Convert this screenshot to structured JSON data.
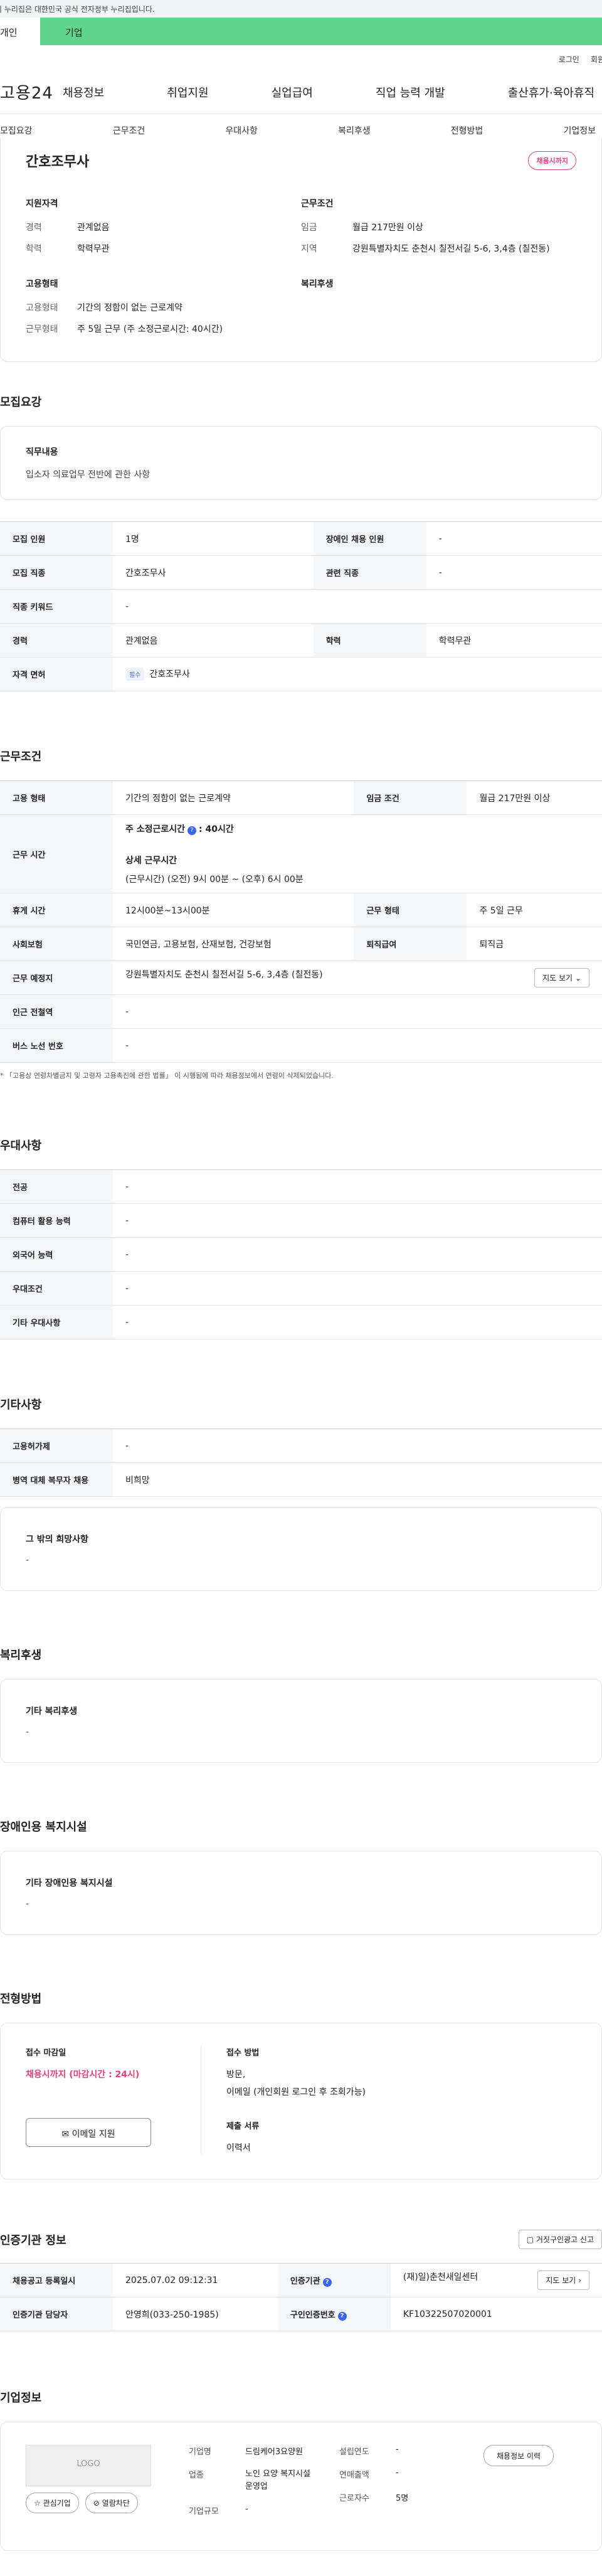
{
  "banner": "이 누리집은 대한민국 공식 전자정부 누리집입니다.",
  "top_tabs": [
    "개인",
    "기업"
  ],
  "util": [
    "로그인",
    "회원가입"
  ],
  "logo": "고용24",
  "gnb": [
    "채용정보",
    "취업지원",
    "실업급여",
    "직업 능력 개발",
    "출산휴가·육아휴직"
  ],
  "subnav": [
    "모집요강",
    "근무조건",
    "우대사항",
    "복리후생",
    "전형방법",
    "기업정보"
  ],
  "summary": {
    "title": "간호조무사",
    "badge": "채용시까지",
    "col1_title": "지원자격",
    "col1": [
      {
        "k": "경력",
        "v": "관계없음"
      },
      {
        "k": "학력",
        "v": "학력무관"
      }
    ],
    "col2_title": "근무조건",
    "col2": [
      {
        "k": "임금",
        "v": "월급 217만원 이상"
      },
      {
        "k": "지역",
        "v": "강원특별자치도 춘천시 칠전서길 5-6, 3,4층 (칠전동)"
      }
    ],
    "col3_title": "고용형태",
    "col3": [
      {
        "k": "고용형태",
        "v": "기간의 정함이 없는 근로계약"
      },
      {
        "k": "근무형태",
        "v": "주 5일 근무 (주 소정근로시간: 40시간)"
      }
    ],
    "col4_title": "복리후생"
  },
  "recruit": {
    "title": "모집요강",
    "duty_label": "직무내용",
    "duty": "입소자 의료업무 전반에 관한 사항",
    "rows": [
      [
        "모집 인원",
        "1명",
        "장애인 채용 인원",
        "-"
      ],
      [
        "모집 직종",
        "간호조무사",
        "관련 직종",
        "-"
      ],
      [
        "직종 키워드",
        "-"
      ],
      [
        "경력",
        "관계없음",
        "학력",
        "학력무관"
      ]
    ],
    "license_label": "자격 면허",
    "license_tag": "필수",
    "license": "간호조무사"
  },
  "work": {
    "title": "근무조건",
    "type_label": "고용 형태",
    "type": "기간의 정함이 없는 근로계약",
    "wage_label": "임금 조건",
    "wage": "월급 217만원 이상",
    "hours_label": "근무 시간",
    "hours_main": "주 소정근로시간",
    "hours_val": ": 40시간",
    "hours_sub": "상세 근무시간",
    "hours_detail": "(근무시간) (오전) 9시 00분 ~ (오후) 6시 00분",
    "break_label": "휴게 시간",
    "break": "12시00분~13시00분",
    "form_label": "근무 형태",
    "form": "주 5일 근무",
    "ins_label": "사회보험",
    "ins": "국민연금, 고용보험, 산재보험, 건강보험",
    "sev_label": "퇴직급여",
    "sev": "퇴직금",
    "loc_label": "근무 예정지",
    "loc": "강원특별자치도 춘천시 칠전서길 5-6, 3,4층 (칠전동)",
    "map_btn": "지도 보기",
    "sub_label": "인근 전철역",
    "sub": "-",
    "bus_label": "버스 노선 번호",
    "bus": "-",
    "note": "* 「고용상 연령차별금지 및 고령자 고용촉진에 관한 법률」 이 시행됨에 따라 채용정보에서 연령이 삭제되었습니다."
  },
  "pref": {
    "title": "우대사항",
    "rows": [
      [
        "전공",
        "-"
      ],
      [
        "컴퓨터 활용 능력",
        "-"
      ],
      [
        "외국어 능력",
        "-"
      ],
      [
        "우대조건",
        "-"
      ],
      [
        "기타 우대사항",
        "-"
      ]
    ]
  },
  "etc": {
    "title": "기타사항",
    "rows": [
      [
        "고용허가제",
        "-"
      ],
      [
        "병역 대체 복무자 채용",
        "비희망"
      ]
    ],
    "box_title": "그 밖의 희망사항",
    "box_val": "-"
  },
  "welfare": {
    "title": "복리후생",
    "box_title": "기타 복리후생",
    "box_val": "-"
  },
  "disabled": {
    "title": "장애인용 복지시설",
    "box_title": "기타 장애인용 복지시설",
    "box_val": "-"
  },
  "apply": {
    "title": "전형방법",
    "deadline_label": "접수 마감일",
    "deadline": "채용시까지 (마감시간 : 24시)",
    "email_btn": "이메일 지원",
    "method_label": "접수 방법",
    "method1": "방문,",
    "method2": "이메일 (개인회원 로그인 후 조회가능)",
    "docs_label": "제출 서류",
    "docs": "이력서"
  },
  "agency": {
    "title": "인증기관 정보",
    "report_btn": "거짓구인광고 신고",
    "reg_label": "채용공고 등록일시",
    "reg": "2025.07.02 09:12:31",
    "org_label": "인증기관",
    "org": "(재)일)춘천새일센터",
    "map_btn": "지도 보기",
    "mgr_label": "인증기관 담당자",
    "mgr": "안영희(033-250-1985)",
    "no_label": "구인인증번호",
    "no": "KF10322507020001"
  },
  "company": {
    "title": "기업정보",
    "logo": "LOGO",
    "fav": "관심기업",
    "block": "열람차단",
    "history_btn": "채용정보 이력",
    "name_label": "기업명",
    "name": "드림케어3요양원",
    "industry_label": "업종",
    "industry": "노인 요양 복지시설 운영업",
    "size_label": "기업규모",
    "size": "-",
    "year_label": "설립연도",
    "year": "-",
    "sales_label": "연매출액",
    "sales": "-",
    "staff_label": "근로자수",
    "staff": "5명"
  }
}
